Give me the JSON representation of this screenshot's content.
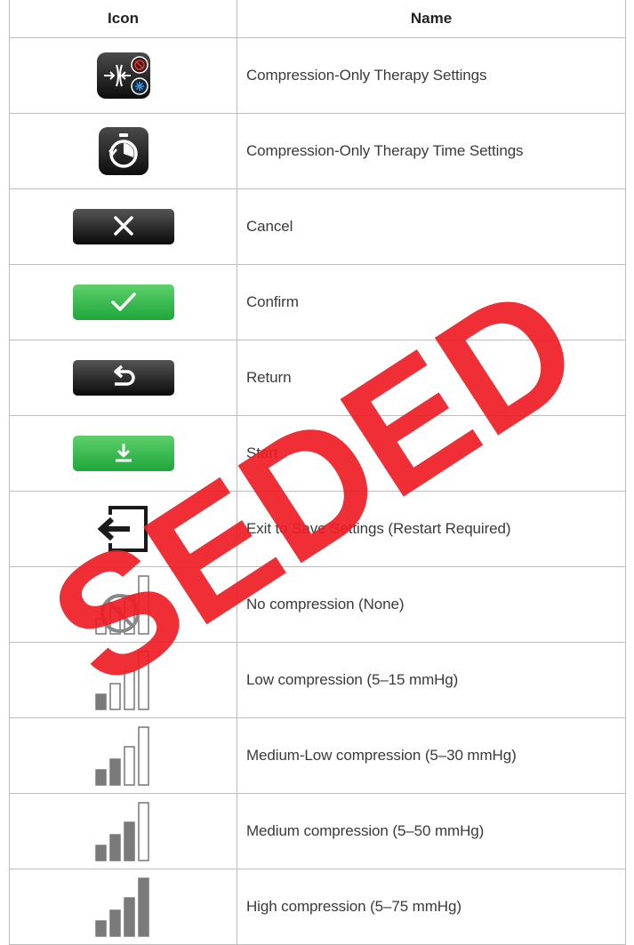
{
  "table": {
    "headers": {
      "icon": "Icon",
      "name": "Name"
    },
    "rows": [
      {
        "icon": "compression-only-therapy-settings-icon",
        "name": "Compression-Only Therapy Settings"
      },
      {
        "icon": "stopwatch-icon",
        "name": "Compression-Only Therapy Time Settings"
      },
      {
        "icon": "cancel-x-icon",
        "name": "Cancel"
      },
      {
        "icon": "confirm-check-icon",
        "name": "Confirm"
      },
      {
        "icon": "return-arrow-icon",
        "name": "Return"
      },
      {
        "icon": "start-download-icon",
        "name": "Start"
      },
      {
        "icon": "exit-save-icon",
        "name": "Exit to Save Settings (Restart Required)"
      },
      {
        "icon": "no-compression-icon",
        "name": "No compression (None)",
        "level": 0
      },
      {
        "icon": "compression-level-icon",
        "name": "Low compression (5–15 mmHg)",
        "level": 1
      },
      {
        "icon": "compression-level-icon",
        "name": "Medium-Low compression (5–30 mmHg)",
        "level": 2
      },
      {
        "icon": "compression-level-icon",
        "name": "Medium compression (5–50 mmHg)",
        "level": 3
      },
      {
        "icon": "compression-level-icon",
        "name": "High compression (5–75 mmHg)",
        "level": 4
      }
    ]
  },
  "watermark": {
    "text": "SEDED",
    "color": "#ee1c25"
  },
  "colors": {
    "dark_button": "#1a1a1a",
    "green_button": "#2db84a",
    "bar_gray": "#7a7a7a",
    "border": "#bdbdbd"
  }
}
